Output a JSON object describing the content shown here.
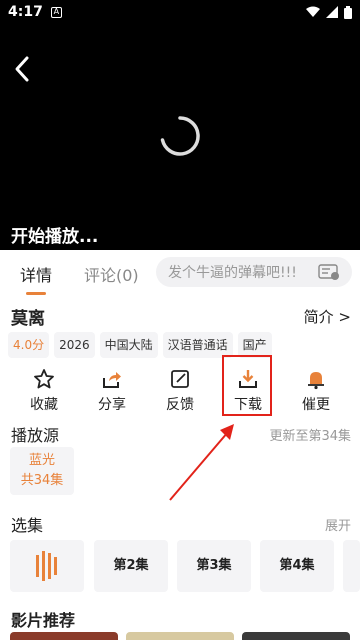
{
  "status_bar": {
    "time": "4:17",
    "notif_letter": "A"
  },
  "player": {
    "start_text": "开始播放..."
  },
  "tabs": {
    "detail": "详情",
    "comment": "评论(0)",
    "danmu_placeholder": "发个牛逼的弹幕吧!!!"
  },
  "show": {
    "title": "莫离",
    "intro": "简介 >"
  },
  "tags": [
    "4.0分",
    "2026",
    "中国大陆",
    "汉语普通话",
    "国产"
  ],
  "actions": [
    {
      "label": "收藏",
      "icon": "star-icon"
    },
    {
      "label": "分享",
      "icon": "share-icon"
    },
    {
      "label": "反馈",
      "icon": "edit-icon"
    },
    {
      "label": "下载",
      "icon": "download-icon"
    },
    {
      "label": "催更",
      "icon": "bell-icon"
    }
  ],
  "source": {
    "title": "播放源",
    "update": "更新至第34集",
    "card_line1": "蓝光",
    "card_line2": "共34集"
  },
  "episodes": {
    "title": "选集",
    "expand": "展开",
    "items": [
      "第2集",
      "第3集",
      "第4集"
    ]
  },
  "recommend": {
    "title": "影片推荐"
  },
  "colors": {
    "accent": "#e8823a",
    "highlight": "#e2231a"
  }
}
